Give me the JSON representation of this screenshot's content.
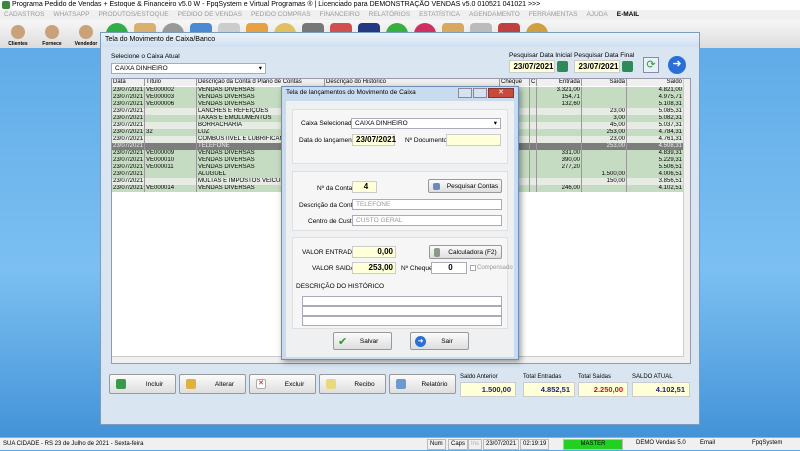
{
  "app": {
    "title": "Programa Pedido de Vendas + Estoque & Financeiro v5.0 W - FpqSystem e Virtual Programas ® | Licenciado para  DEMONSTRAÇÃO VENDAS v5.0 010521 041021 >>>"
  },
  "menu": [
    "CADASTROS",
    "WHATSAPP",
    "PRODUTOS/ESTOQUE",
    "PEDIDO DE VENDAS",
    "PEDIDO COMPRAS",
    "FINANCEIRO",
    "RELATÓRIOS",
    "ESTATÍSTICA",
    "AGENDAMENTO",
    "FERRAMENTAS",
    "AJUDA"
  ],
  "menu_email": "E-MAIL",
  "toolbar": {
    "clientes": "Clientes",
    "fornece": "Fornece",
    "vendedor": "Vendedor"
  },
  "window": {
    "title": "Tela do Movimento de Caixa/Banco",
    "caixa_label": "Selecione o Caixa Atual",
    "caixa_value": "CAIXA DINHEIRO",
    "data_ini_label": "Pesquisar Data Inicial",
    "data_ini": "23/07/2021",
    "data_fim_label": "Pesquisar Data Final",
    "data_fim": "23/07/2021"
  },
  "grid": {
    "headers": [
      "Data",
      "Título",
      "Descrição da Conta d Plano de Contas",
      "Descrição do Histórico",
      "Cheque",
      "C",
      "Entrada",
      "Saída",
      "Saldo"
    ],
    "rows": [
      [
        "23/07/2021",
        "VE000002",
        "VENDAS DIVERSAS",
        "",
        "",
        "",
        "3.321,00",
        "",
        "4.821,00"
      ],
      [
        "23/07/2021",
        "VE000003",
        "VENDAS DIVERSAS",
        "",
        "",
        "",
        "154,71",
        "",
        "4.975,71"
      ],
      [
        "23/07/2021",
        "VE000006",
        "VENDAS DIVERSAS",
        "",
        "",
        "",
        "132,60",
        "",
        "5.108,31"
      ],
      [
        "23/07/2021",
        "",
        "LANCHES E REFEIÇÕES",
        "",
        "",
        "",
        "",
        "23,00",
        "5.085,31"
      ],
      [
        "23/07/2021",
        "",
        "TAXAS E EMOLUMENTOS",
        "",
        "",
        "",
        "",
        "3,00",
        "5.082,31"
      ],
      [
        "23/07/2021",
        "",
        "BORRACHARIA",
        "",
        "",
        "",
        "",
        "45,00",
        "5.037,31"
      ],
      [
        "23/07/2021",
        "32",
        "LUZ",
        "",
        "",
        "",
        "",
        "253,00",
        "4.784,31"
      ],
      [
        "23/07/2021",
        "",
        "COMBUSTÍVEL E LUBRIFICANTE",
        "",
        "",
        "",
        "",
        "23,00",
        "4.761,31"
      ],
      [
        "23/07/2021",
        "",
        "TELEFONE",
        "",
        "",
        "",
        "",
        "253,00",
        "4.508,31"
      ],
      [
        "23/07/2021",
        "VE000009",
        "VENDAS DIVERSAS",
        "",
        "",
        "",
        "331,00",
        "",
        "4.839,31"
      ],
      [
        "23/07/2021",
        "VE000010",
        "VENDAS DIVERSAS",
        "",
        "",
        "",
        "390,00",
        "",
        "5.229,31"
      ],
      [
        "23/07/2021",
        "VE000011",
        "VENDAS DIVERSAS",
        "",
        "",
        "",
        "277,20",
        "",
        "5.506,51"
      ],
      [
        "23/07/2021",
        "",
        "ALUGUEL",
        "",
        "",
        "",
        "",
        "1.500,00",
        "4.006,51"
      ],
      [
        "23/07/2021",
        "",
        "MULTAS E IMPOSTOS VEICULAR",
        "",
        "",
        "",
        "",
        "150,00",
        "3.856,51"
      ],
      [
        "23/07/2021",
        "VE000014",
        "VENDAS DIVERSAS",
        "",
        "",
        "",
        "246,00",
        "",
        "4.102,51"
      ]
    ],
    "selected_row": 8
  },
  "buttons": {
    "incluir": "Incluir",
    "alterar": "Alterar",
    "excluir": "Excluir",
    "recibo": "Recibo",
    "relatorio": "Relatório"
  },
  "totals": {
    "saldo_anterior_label": "Saldo Anterior",
    "saldo_anterior": "1.500,00",
    "entradas_label": "Total Entradas",
    "entradas": "4.852,51",
    "saidas_label": "Total Saídas",
    "saidas": "2.250,00",
    "atual_label": "SALDO ATUAL",
    "atual": "4.102,51"
  },
  "dialog": {
    "title": "Tela de lançamentos do Movimento de Caixa",
    "caixa_label": "Caixa Selecionado",
    "caixa": "CAIXA DINHEIRO",
    "data_label": "Data do lançamento",
    "data": "23/07/2021",
    "doc_label": "Nº Documento",
    "doc": "",
    "conta_label": "Nº da Conta",
    "conta": "4",
    "pesquisar": "Pesquisar Contas",
    "desc_label": "Descrição da Conta",
    "desc": "TELEFONE",
    "centro_label": "Centro de Custo",
    "centro": "CUSTO GERAL",
    "entrada_label": "VALOR ENTRADA",
    "entrada": "0,00",
    "calc": "Calculadora  (F2)",
    "saida_label": "VALOR SAIDA",
    "saida": "253,00",
    "cheque_label": "Nº Cheque",
    "cheque": "0",
    "compensado": "Compensado",
    "hist_label": "DESCRIÇÃO DO HISTÓRICO",
    "salvar": "Salvar",
    "sair": "Sair"
  },
  "status": {
    "city": "SUA CIDADE - RS 23 de Julho de 2021 - Sexta-feira",
    "num": "Num",
    "caps": "Caps",
    "ins": "Ins",
    "date": "23/07/2021",
    "time": "02:19:19",
    "user": "MASTER",
    "version": "DEMO Vendas 5.0",
    "email": "Email",
    "brand": "FpqSystem"
  }
}
